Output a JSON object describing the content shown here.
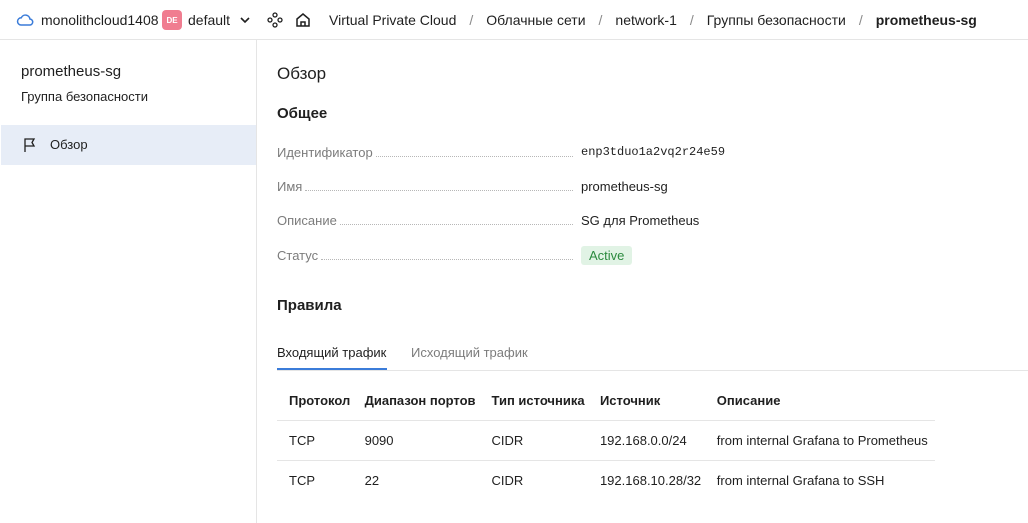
{
  "topbar": {
    "cloud_name": "monolithcloud1408",
    "folder_badge": "DE",
    "folder_name": "default",
    "icons": [
      "cloud-icon",
      "chevron-down-icon",
      "services-icon",
      "home-icon"
    ],
    "breadcrumbs": [
      "Virtual Private Cloud",
      "Облачные сети",
      "network-1",
      "Группы безопасности",
      "prometheus-sg"
    ],
    "separator": "/"
  },
  "sidebar": {
    "title": "prometheus-sg",
    "subtitle": "Группа безопасности",
    "items": [
      {
        "label": "Обзор",
        "icon": "flag-icon",
        "selected": true
      }
    ]
  },
  "main": {
    "page_title": "Обзор",
    "general_title": "Общее",
    "properties": [
      {
        "key": "Идентификатор",
        "value": "enp3tduo1a2vq2r24e59"
      },
      {
        "key": "Имя",
        "value": "prometheus-sg"
      },
      {
        "key": "Описание",
        "value": "SG для Prometheus"
      },
      {
        "key": "Статус",
        "value": "Active"
      }
    ],
    "rules_title": "Правила",
    "tabs": [
      {
        "label": "Входящий трафик",
        "active": true
      },
      {
        "label": "Исходящий трафик",
        "active": false
      }
    ],
    "table": {
      "headers": [
        "Протокол",
        "Диапазон портов",
        "Тип источника",
        "Источник",
        "Описание"
      ],
      "rows": [
        [
          "TCP",
          "9090",
          "CIDR",
          "192.168.0.0/24",
          "from internal Grafana to Prometheus"
        ],
        [
          "TCP",
          "22",
          "CIDR",
          "192.168.10.28/32",
          "from internal Grafana to SSH"
        ]
      ]
    }
  },
  "colors": {
    "accent": "#3b7cd9",
    "badge": "#f07d90",
    "selected_bg": "#e7edf7",
    "status_bg": "#e1f3e5",
    "status_text": "#2b8a3e"
  }
}
